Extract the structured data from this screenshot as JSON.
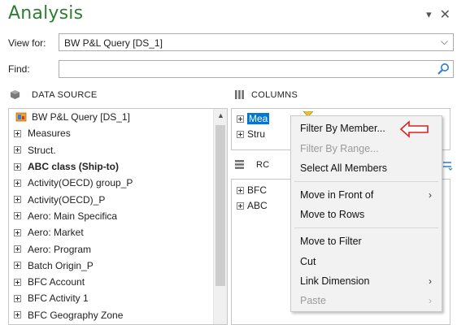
{
  "header": {
    "title": "Analysis",
    "dropdown_icon": "chevron-down-icon",
    "close_icon": "close-icon"
  },
  "view_for": {
    "label": "View for:",
    "value": "BW P&L Query [DS_1]"
  },
  "find": {
    "label": "Find:",
    "value": "",
    "placeholder": ""
  },
  "sections": {
    "data_source": "DATA SOURCE",
    "columns": "COLUMNS",
    "rows": "RC"
  },
  "data_source": {
    "root": "BW P&L Query [DS_1]",
    "items": [
      {
        "label": "Measures",
        "bold": false
      },
      {
        "label": "Struct.",
        "bold": false
      },
      {
        "label": "ABC class (Ship-to)",
        "bold": true
      },
      {
        "label": "Activity(OECD) group_P",
        "bold": false
      },
      {
        "label": "Activity(OECD)_P",
        "bold": false
      },
      {
        "label": "Aero: Main Specifica",
        "bold": false
      },
      {
        "label": "Aero: Market",
        "bold": false
      },
      {
        "label": "Aero: Program",
        "bold": false
      },
      {
        "label": "Batch Origin_P",
        "bold": false
      },
      {
        "label": "BFC Account",
        "bold": false
      },
      {
        "label": "BFC Activity 1",
        "bold": false
      },
      {
        "label": "BFC Geography Zone",
        "bold": false
      }
    ]
  },
  "columns": {
    "items": [
      "Mea",
      "Stru"
    ]
  },
  "rows": {
    "items": [
      "BFC",
      "ABC"
    ]
  },
  "context_menu": {
    "items": [
      {
        "label": "Filter By Member...",
        "disabled": false,
        "submenu": false
      },
      {
        "label": "Filter By Range...",
        "disabled": true,
        "submenu": false
      },
      {
        "label": "Select All Members",
        "disabled": false,
        "submenu": false
      },
      {
        "label": "Move in Front of",
        "disabled": false,
        "submenu": true
      },
      {
        "label": "Move to Rows",
        "disabled": false,
        "submenu": false
      },
      {
        "label": "Move to Filter",
        "disabled": false,
        "submenu": false
      },
      {
        "label": "Cut",
        "disabled": false,
        "submenu": false
      },
      {
        "label": "Link Dimension",
        "disabled": false,
        "submenu": true
      },
      {
        "label": "Paste",
        "disabled": true,
        "submenu": true
      }
    ]
  },
  "colors": {
    "title": "#2e7d32",
    "selection": "#0078d7",
    "annotation_arrow": "#e01f1f"
  }
}
